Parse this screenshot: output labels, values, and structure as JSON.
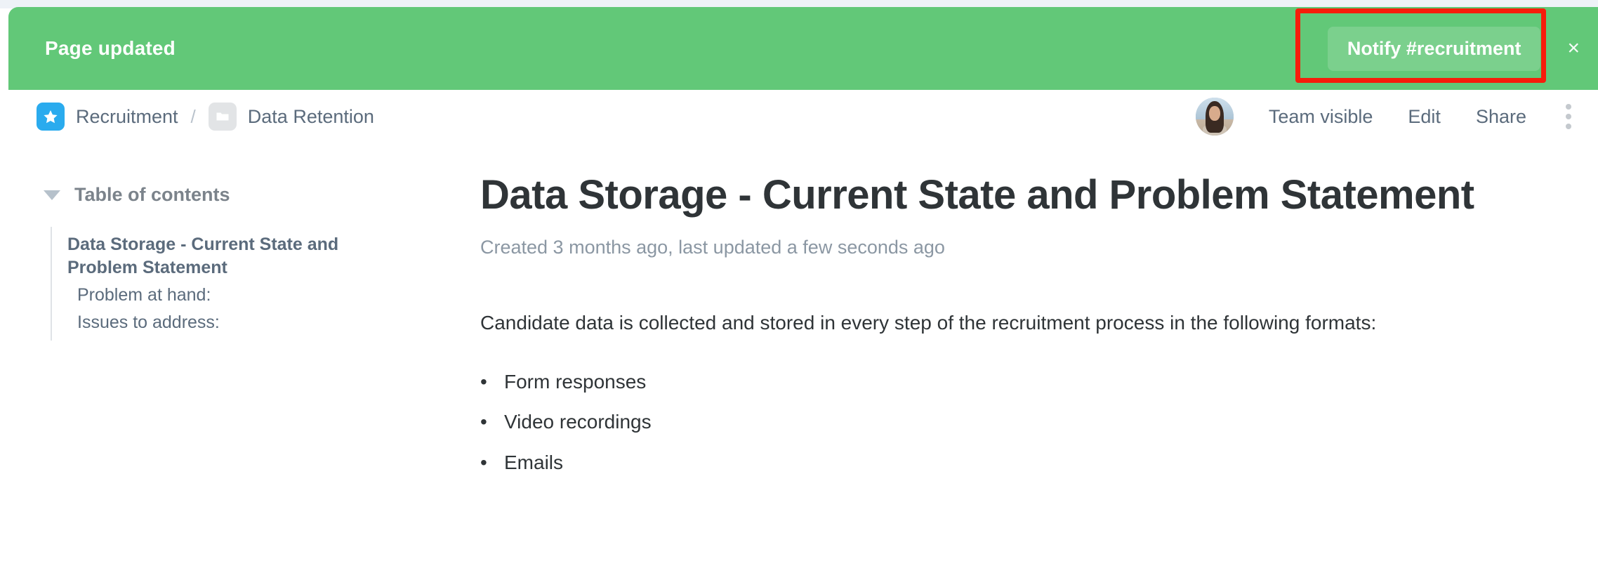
{
  "banner": {
    "title": "Page updated",
    "notify_label": "Notify #recruitment",
    "close_label": "×",
    "bg_color": "#62c878",
    "highlight_color": "#f71d0b"
  },
  "header": {
    "breadcrumb": {
      "space_icon": "star-icon",
      "space_label": "Recruitment",
      "separator": "/",
      "page_icon": "folder-icon",
      "page_label": "Data Retention"
    },
    "avatar_icon": "user-avatar",
    "actions": [
      {
        "label": "Team visible",
        "name": "team-visible-button"
      },
      {
        "label": "Edit",
        "name": "edit-button"
      },
      {
        "label": "Share",
        "name": "share-button"
      }
    ],
    "more_icon": "kebab-menu-icon"
  },
  "toc": {
    "caret_icon": "chevron-down-icon",
    "title": "Table of contents",
    "items": [
      {
        "label": "Data Storage - Current State and Problem Statement",
        "level": 1
      },
      {
        "label": "Problem at hand:",
        "level": 2
      },
      {
        "label": "Issues to address:",
        "level": 2
      }
    ]
  },
  "document": {
    "title": "Data Storage - Current State and Problem Statement",
    "meta": "Created 3 months ago, last updated a few seconds ago",
    "paragraph": "Candidate data is collected and stored in every step of the recruitment process in the following formats:",
    "bullets": [
      "Form responses",
      "Video recordings",
      "Emails"
    ]
  }
}
